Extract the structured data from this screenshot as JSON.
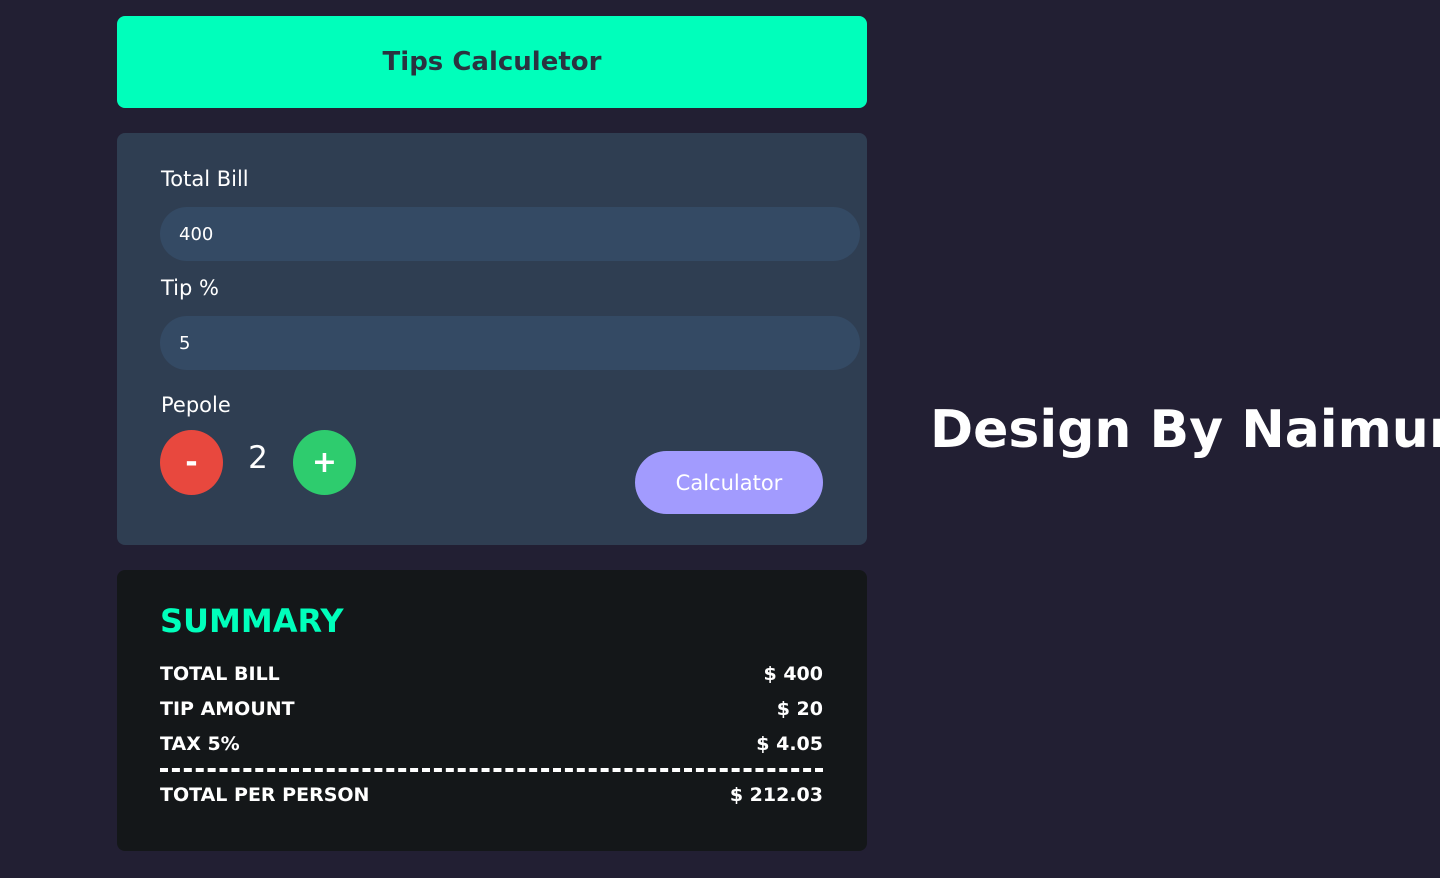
{
  "header": {
    "title": "Tips Calculetor"
  },
  "form": {
    "total_bill_label": "Total Bill",
    "total_bill_value": "400",
    "tip_label": "Tip %",
    "tip_value": "5",
    "people_label": "Pepole",
    "people_count": "2",
    "minus_label": "-",
    "plus_label": "+",
    "calculate_label": "Calculator"
  },
  "summary": {
    "title": "SUMMARY",
    "rows": [
      {
        "label": "TOTAL BILL",
        "value": "$ 400"
      },
      {
        "label": "TIP AMOUNT",
        "value": "$ 20"
      },
      {
        "label": "TAX 5%",
        "value": "$ 4.05"
      }
    ],
    "total": {
      "label": "TOTAL PER PERSON",
      "value": "$ 212.03"
    }
  },
  "signature": "Design By Naimur",
  "colors": {
    "background": "#221f33",
    "accent": "#00ffbb",
    "card": "#2f3e52",
    "input": "#344a64",
    "minus": "#e8483e",
    "plus": "#2ecc6e",
    "calculate": "#a29bfe",
    "summary_bg": "#141719"
  }
}
